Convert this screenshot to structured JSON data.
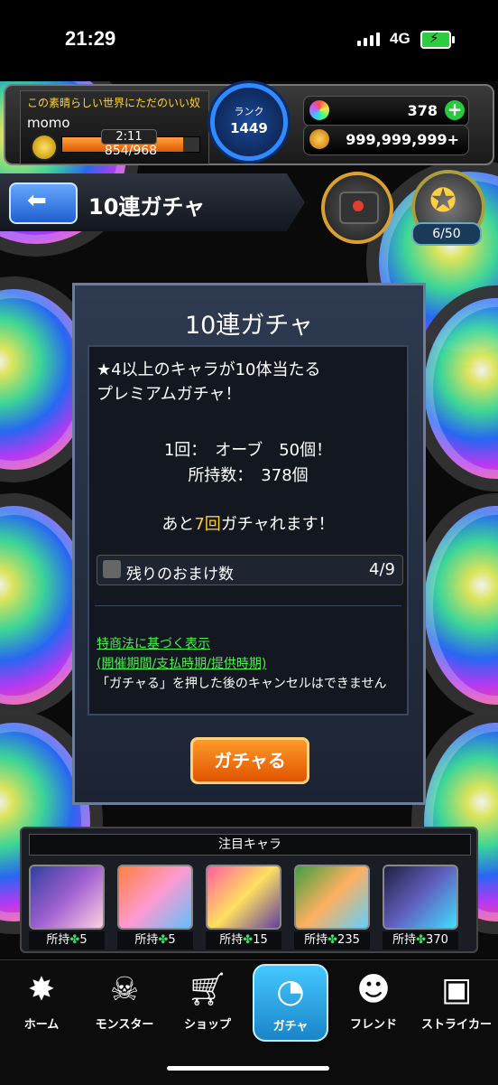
{
  "status_bar": {
    "time": "21:29",
    "network": "4G"
  },
  "header": {
    "player_title": "この素晴らしい世界にただのいい奴",
    "player_name": "momo",
    "stamina_timer": "2:11",
    "stamina_value": "854/968",
    "stamina_level": 0.88,
    "rank_label": "ランク",
    "rank_value": "1449",
    "orbs": "378",
    "coins": "999,999,999+"
  },
  "nav": {
    "title": "10連ガチャ",
    "badge_count": "6/50"
  },
  "dialog": {
    "title": "10連ガチャ",
    "description_line1": "★4以上のキャラが10体当たる",
    "description_line2": "プレミアムガチャ！",
    "cost_line": "1回：　オーブ　50個！",
    "owned_line": "所持数：　378個",
    "remaining_prefix": "あと",
    "remaining_count": "7回",
    "remaining_suffix": "ガチャれます！",
    "bonus_label": "残りのおまけ数",
    "bonus_value": "4/9",
    "legal_link1": "特商法に基づく表示",
    "legal_link2": "(開催期間/支払時期/提供時期)",
    "cancel_note": "「ガチャる」を押した後のキャンセルはできません",
    "gacha_button": "ガチャる"
  },
  "featured": {
    "title": "注目キャラ",
    "cards": [
      {
        "owned_label": "所持",
        "count": "5"
      },
      {
        "owned_label": "所持",
        "count": "5"
      },
      {
        "owned_label": "所持",
        "count": "15"
      },
      {
        "owned_label": "所持",
        "count": "235"
      },
      {
        "owned_label": "所持",
        "count": "370"
      }
    ]
  },
  "bottom_nav": {
    "items": [
      {
        "label": "ホーム",
        "icon": "home-icon"
      },
      {
        "label": "モンスター",
        "icon": "monster-icon"
      },
      {
        "label": "ショップ",
        "icon": "shop-cart-icon"
      },
      {
        "label": "ガチャ",
        "icon": "gacha-egg-icon"
      },
      {
        "label": "フレンド",
        "icon": "friend-icon"
      },
      {
        "label": "ストライカー",
        "icon": "striker-card-icon"
      }
    ]
  }
}
